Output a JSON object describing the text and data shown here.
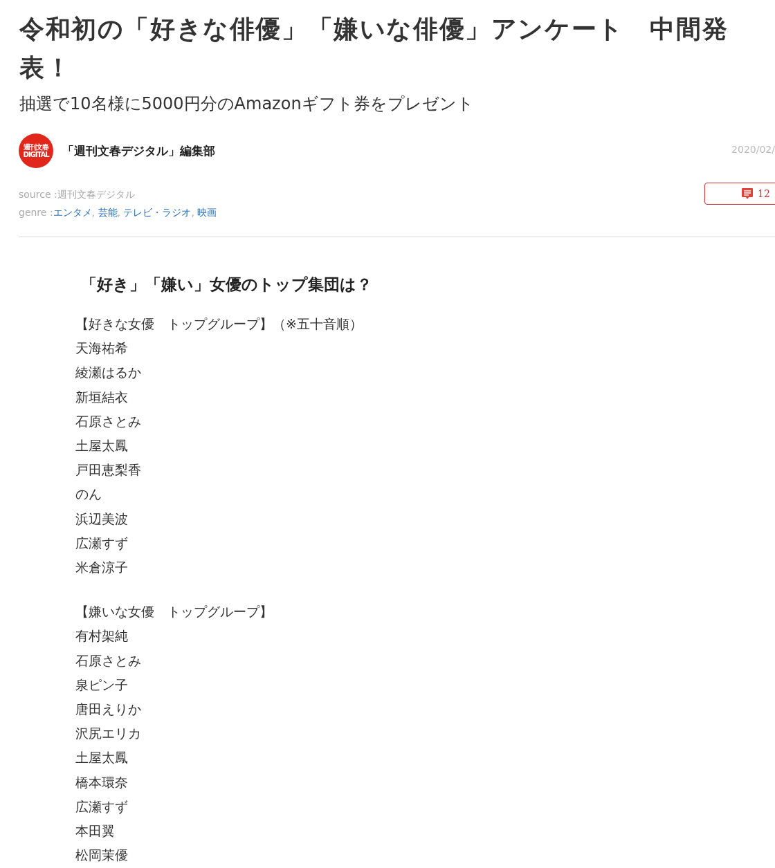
{
  "title": "令和初の「好きな俳優」「嫌いな俳優」アンケート　中間発表！",
  "subtitle": "抽選で10名様に5000円分のAmazonギフト券をプレゼント",
  "author": {
    "logo_lines": [
      "週刊文春",
      "DIGITAL"
    ],
    "name": "「週刊文春デジタル」編集部",
    "date": "2020/02/"
  },
  "source": {
    "label": "source :",
    "value": "週刊文春デジタル"
  },
  "genre": {
    "label": "genre :",
    "separator": ",",
    "links": [
      "エンタメ",
      "芸能",
      "テレビ・ラジオ",
      "映画"
    ]
  },
  "comments": {
    "count": "12"
  },
  "section_heading": "「好き」「嫌い」女優のトップ集団は？",
  "groups": [
    {
      "heading": "【好きな女優　トップグループ】（※五十音順）",
      "names": [
        "天海祐希",
        "綾瀬はるか",
        "新垣結衣",
        "石原さとみ",
        "土屋太鳳",
        "戸田恵梨香",
        "のん",
        "浜辺美波",
        "広瀬すず",
        "米倉涼子"
      ]
    },
    {
      "heading": "【嫌いな女優　トップグループ】",
      "names": [
        "有村架純",
        "石原さとみ",
        "泉ピン子",
        "唐田えりか",
        "沢尻エリカ",
        "土屋太鳳",
        "橋本環奈",
        "広瀬すず",
        "本田翼",
        "松岡茉優"
      ]
    }
  ]
}
